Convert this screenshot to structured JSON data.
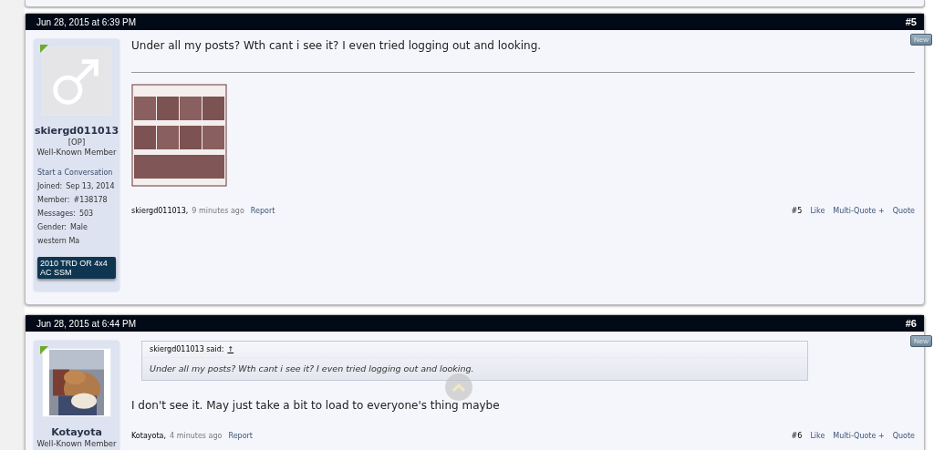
{
  "posts": [
    {
      "date": "Jun 28, 2015 at 6:39 PM",
      "number": "#5",
      "badge": "New",
      "user": {
        "avatar": {
          "kind": "symbol"
        },
        "name": "skiergd011013",
        "tag": "[OP]",
        "title": "Well-Known Member",
        "start_link": "Start a Conversation",
        "stats": [
          {
            "label": "Joined:",
            "value": "Sep 13, 2014"
          },
          {
            "label": "Member:",
            "value": "#138178"
          },
          {
            "label": "Messages:",
            "value": "503"
          },
          {
            "label": "Gender:",
            "value": "Male"
          }
        ],
        "location": "western Ma",
        "banner": "2010 TRD OR 4x4 AC SSM"
      },
      "message": "Under all my posts? Wth cant i see it? I even tried logging out and looking.",
      "footer": {
        "author": "skiergd011013,",
        "time": "9 minutes ago",
        "report": "Report",
        "number": "#5",
        "actions": [
          "Like",
          "Multi-Quote +",
          "Quote"
        ]
      }
    },
    {
      "date": "Jun 28, 2015 at 6:44 PM",
      "number": "#6",
      "badge": "New",
      "user": {
        "name": "Kotayota",
        "title": "Well-Known Member"
      },
      "quote": {
        "attribution": "skiergd011013 said:",
        "link": "↑",
        "text": "Under all my posts? Wth cant i see it? I even tried logging out and looking."
      },
      "message": "I don't see it. May just take a bit to load to everyone's thing maybe",
      "footer": {
        "author": "Kotayota,",
        "time": "4 minutes ago",
        "report": "Report",
        "number": "#6",
        "actions": [
          "Like",
          "Multi-Quote +",
          "Quote"
        ]
      }
    }
  ]
}
